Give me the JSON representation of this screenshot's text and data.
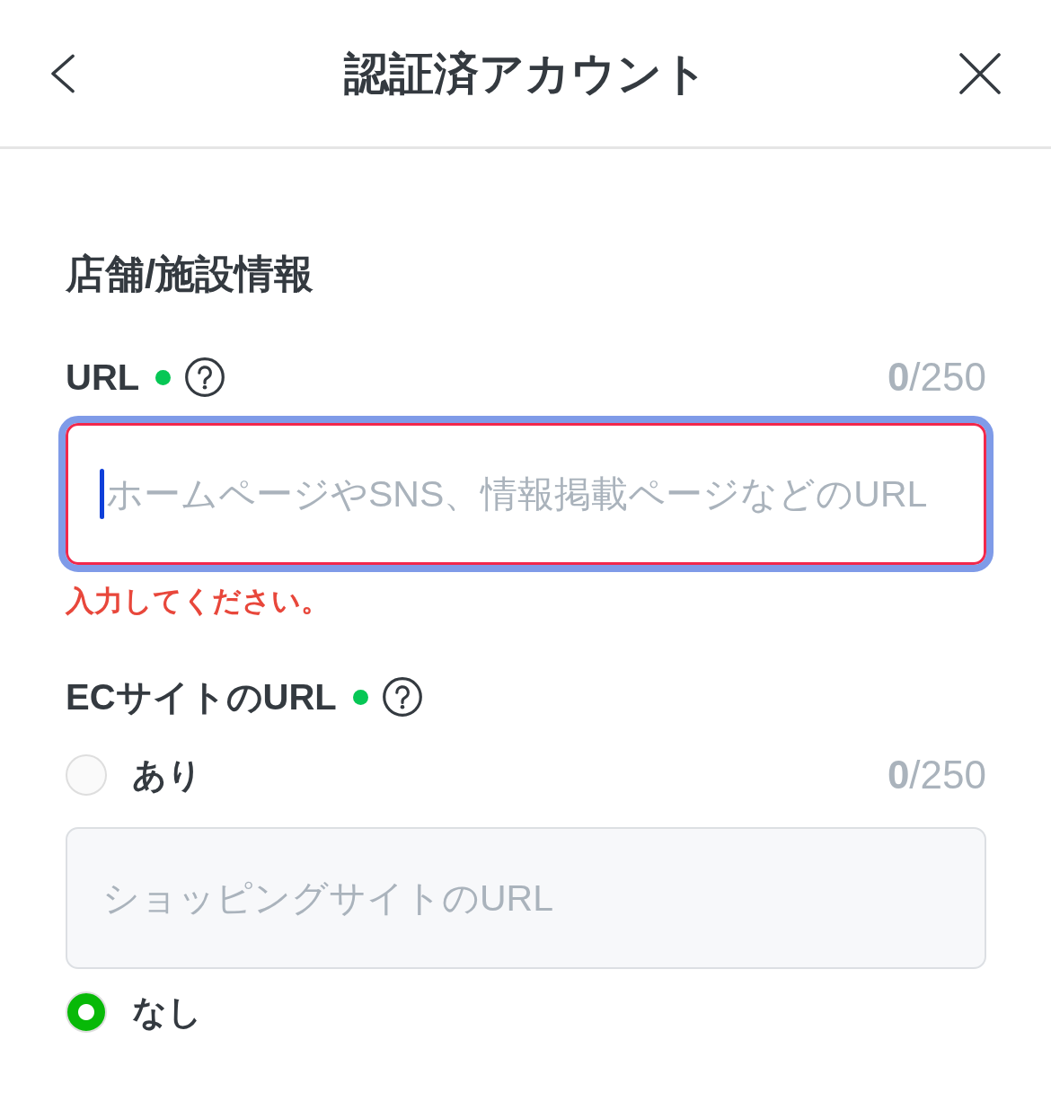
{
  "top_bar": {
    "title": "認証済アカウント"
  },
  "section": {
    "title": "店舗/施設情報",
    "fields": [
      {
        "kind": "text",
        "label": "URL",
        "required": true,
        "counter": "**0**/250",
        "input": {
          "placeholder": "ホームページやSNS、情報掲載ページなどのURL",
          "focused": true,
          "invalid": true
        },
        "error": "入力してください。"
      },
      {
        "kind": "radio",
        "label": "ECサイトのURL",
        "required": true,
        "options": [
          {
            "label": "あり",
            "selected": false,
            "counter": "**0**/250",
            "input": {
              "placeholder": "ショッピングサイトのURL",
              "focused": false,
              "invalid": false
            }
          },
          {
            "label": "なし",
            "selected": true
          }
        ]
      }
    ]
  }
}
